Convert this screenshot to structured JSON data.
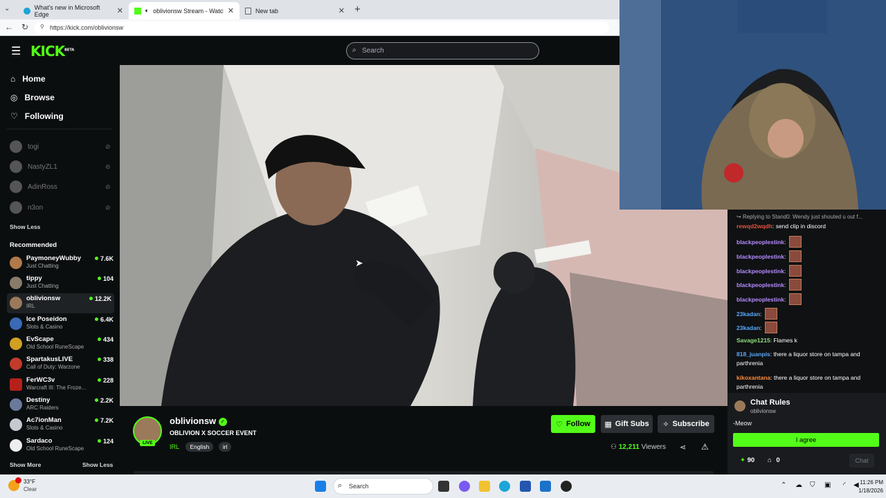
{
  "browser": {
    "tabs": [
      {
        "title": "What's new in Microsoft Edge"
      },
      {
        "title": "oblivionsw Stream - Watch Li"
      },
      {
        "title": "New tab"
      }
    ],
    "url": "https://kick.com/oblivionsw"
  },
  "header": {
    "logo": "KICK",
    "logo_badge": "BETA",
    "search_placeholder": "Search"
  },
  "sidebar": {
    "nav": [
      {
        "label": "Home",
        "icon": "home-icon"
      },
      {
        "label": "Browse",
        "icon": "compass-icon"
      },
      {
        "label": "Following",
        "icon": "heart-icon"
      }
    ],
    "offline": [
      "togi",
      "NastyZL1",
      "AdinRoss",
      "n3on"
    ],
    "show_less_top": "Show Less",
    "recommended_title": "Recommended",
    "recommended": [
      {
        "name": "PaymoneyWubby",
        "category": "Just Chatting",
        "viewers": "7.6K"
      },
      {
        "name": "tippy",
        "category": "Just Chatting",
        "viewers": "104"
      },
      {
        "name": "oblivionsw",
        "category": "IRL",
        "viewers": "12.2K"
      },
      {
        "name": "Ice Poseidon",
        "category": "Slots & Casino",
        "viewers": "6.4K"
      },
      {
        "name": "EvScape",
        "category": "Old School RuneScape",
        "viewers": "434"
      },
      {
        "name": "SpartakusLIVE",
        "category": "Call of Duty: Warzone",
        "viewers": "338"
      },
      {
        "name": "FerWC3v",
        "category": "Warcraft III: The Froze...",
        "viewers": "228"
      },
      {
        "name": "Destiny",
        "category": "ARC Raiders",
        "viewers": "2.2K"
      },
      {
        "name": "Ac7ionMan",
        "category": "Slots & Casino",
        "viewers": "7.2K"
      },
      {
        "name": "Sardaco",
        "category": "Old School RuneScape",
        "viewers": "124"
      }
    ],
    "show_more": "Show More",
    "show_less": "Show Less"
  },
  "chat": {
    "reply_note": "Replying to Stand0: Wendy just shouted u out f...",
    "messages": [
      {
        "user": "rewqd2wqdh",
        "text": "send clip in discord",
        "color": "#e0543e"
      },
      {
        "user": "blackpeoplestink",
        "text": "",
        "color": "#b48cff",
        "emote": true
      },
      {
        "user": "blackpeoplestink",
        "text": "",
        "color": "#b48cff",
        "emote": true
      },
      {
        "user": "blackpeoplestink",
        "text": "",
        "color": "#b48cff",
        "emote": true
      },
      {
        "user": "blackpeoplestink",
        "text": "",
        "color": "#b48cff",
        "emote": true
      },
      {
        "user": "blackpeoplestink",
        "text": "",
        "color": "#b48cff",
        "emote": true
      },
      {
        "user": "23kadan",
        "text": "",
        "color": "#5aa9ff",
        "emote": true
      },
      {
        "user": "23kadan",
        "text": "",
        "color": "#5aa9ff",
        "emote": true
      },
      {
        "user": "Savage1215",
        "text": "Flames k",
        "color": "#8fe07a"
      },
      {
        "user": "818_juanpis",
        "text": "there a liquor store on tampa and parthrenia",
        "color": "#5aa9ff"
      },
      {
        "user": "kikoxantana",
        "text": "there a liquor store on tampa and parthrenia",
        "color": "#ff8c3a"
      }
    ],
    "rules_title": "Chat Rules",
    "rules_owner": "oblivionsw",
    "rules_text": "-Meow",
    "agree": "I agree",
    "points": "90",
    "store_count": "0",
    "chat_button": "Chat"
  },
  "stream": {
    "channel": "oblivionsw",
    "title": "OBLIVION X SOCCER EVENT",
    "live_badge": "LIVE",
    "category": "IRL",
    "tags": [
      "English",
      "irl"
    ],
    "follow": "Follow",
    "gift_subs": "Gift Subs",
    "subscribe": "Subscribe",
    "viewers": "12,211",
    "viewers_label": "Viewers"
  },
  "taskbar": {
    "weather_temp": "33°F",
    "weather_cond": "Clear",
    "search": "Search",
    "time": "11:26 PM",
    "date": "1/18/2026"
  },
  "colors": {
    "accent": "#53fc18",
    "bg": "#0b0e0f"
  }
}
